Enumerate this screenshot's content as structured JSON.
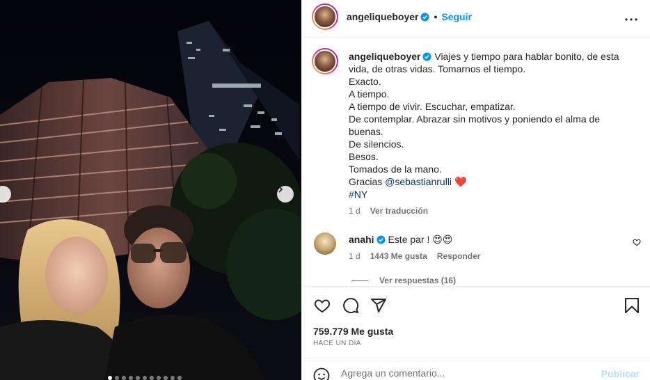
{
  "post": {
    "username": "angeliqueboyer",
    "follow_label": "Seguir",
    "separator": "•"
  },
  "caption": {
    "username": "angeliqueboyer",
    "text_first": "Viajes y tiempo para hablar bonito, de esta vida, de otras vidas. Tomarnos el tiempo.",
    "lines": [
      "Exacto.",
      "A tiempo.",
      "A tiempo de vivir. Escuchar, empatizar.",
      "De contemplar. Abrazar sin motivos y poniendo el alma de buenas.",
      "De silencios.",
      "Besos.",
      "Tomados de la mano."
    ],
    "thanks_prefix": "Gracias ",
    "mention": "@sebastianrulli",
    "heart": "❤️",
    "hashtag": "#NY",
    "age": "1 d",
    "translate_label": "Ver traducción"
  },
  "comment": {
    "username": "anahi",
    "text": "Este par ! 😍😍",
    "age": "1 d",
    "likes": "1443 Me gusta",
    "reply_label": "Responder",
    "view_replies": "Ver respuestas (16)"
  },
  "stats": {
    "likes": "759.779 Me gusta",
    "time": "HACE UN DÍA"
  },
  "composer": {
    "placeholder": "Agrega un comentario...",
    "publish_label": "Publicar"
  },
  "carousel": {
    "dot_count": 11,
    "active_index": 0
  },
  "colors": {
    "link_blue": "#0095f6",
    "mention_blue": "#00376b",
    "muted": "#737373",
    "text": "#262626",
    "publish_disabled": "#b2dffc",
    "heart_red": "#ed4956"
  },
  "icons": {
    "like": "heart-icon",
    "comment": "comment-icon",
    "share": "send-icon",
    "save": "bookmark-icon",
    "more": "more-options-icon",
    "emoji": "emoji-icon",
    "verified": "verified-badge-icon",
    "prev": "chevron-left-icon",
    "next": "chevron-right-icon"
  }
}
